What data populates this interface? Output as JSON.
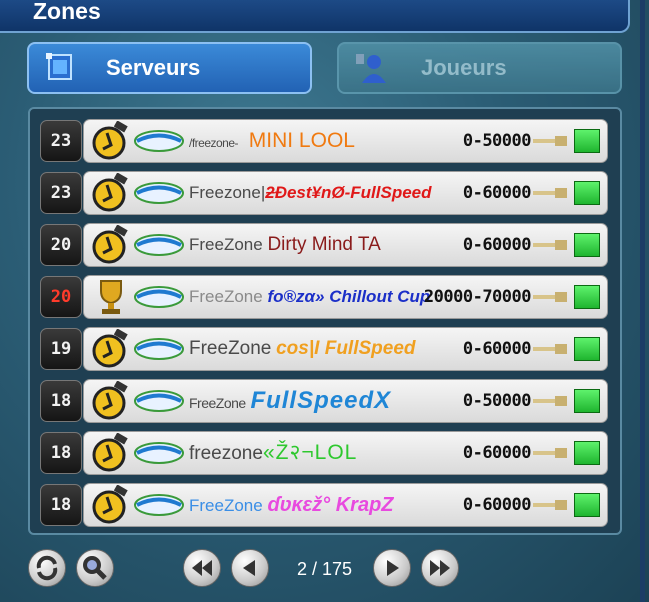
{
  "window": {
    "title": "Zones"
  },
  "tabs": [
    {
      "label": "Serveurs",
      "icon": "server-icon",
      "active": true
    },
    {
      "label": "Joueurs",
      "icon": "players-icon",
      "active": false
    }
  ],
  "servers": [
    {
      "rank": "23",
      "rank_hot": false,
      "medal": "stopwatch-icon",
      "prefix": "/freezone-",
      "prefix_small": true,
      "name": "MINI LOOL",
      "points": "0-50000"
    },
    {
      "rank": "23",
      "rank_hot": false,
      "medal": "stopwatch-icon",
      "prefix": "Freezone|",
      "prefix_small": false,
      "name": "ƻĐest¥nØ-FullSpeed",
      "points": "0-60000"
    },
    {
      "rank": "20",
      "rank_hot": false,
      "medal": "stopwatch-icon",
      "prefix": "FreeZone",
      "prefix_small": false,
      "name": "Dirty Mind TA",
      "points": "0-60000"
    },
    {
      "rank": "20",
      "rank_hot": true,
      "medal": "trophy-icon",
      "prefix": "FreeZone",
      "prefix_small": false,
      "name": "fo®zα» Chillout Cup",
      "points": "20000-70000"
    },
    {
      "rank": "19",
      "rank_hot": false,
      "medal": "stopwatch-icon",
      "prefix": "FreeZone",
      "prefix_small": false,
      "name": "cos|I FullSpeed",
      "points": "0-60000"
    },
    {
      "rank": "18",
      "rank_hot": false,
      "medal": "stopwatch-icon",
      "prefix": "FreeZone",
      "prefix_small": true,
      "name": "FullSpeedX",
      "points": "0-50000"
    },
    {
      "rank": "18",
      "rank_hot": false,
      "medal": "stopwatch-icon",
      "prefix": "freezone",
      "prefix_small": false,
      "name": "«Ž२¬LOL",
      "points": "0-60000"
    },
    {
      "rank": "18",
      "rank_hot": false,
      "medal": "stopwatch-icon",
      "prefix": "FreeZone",
      "prefix_small": false,
      "name": "ɗʋĸɛž° KrapZ",
      "points": "0-60000"
    }
  ],
  "pager": {
    "text": "2 / 175"
  },
  "colors": {
    "status_online": "#22c232",
    "accent_blue": "#2b73c8"
  }
}
